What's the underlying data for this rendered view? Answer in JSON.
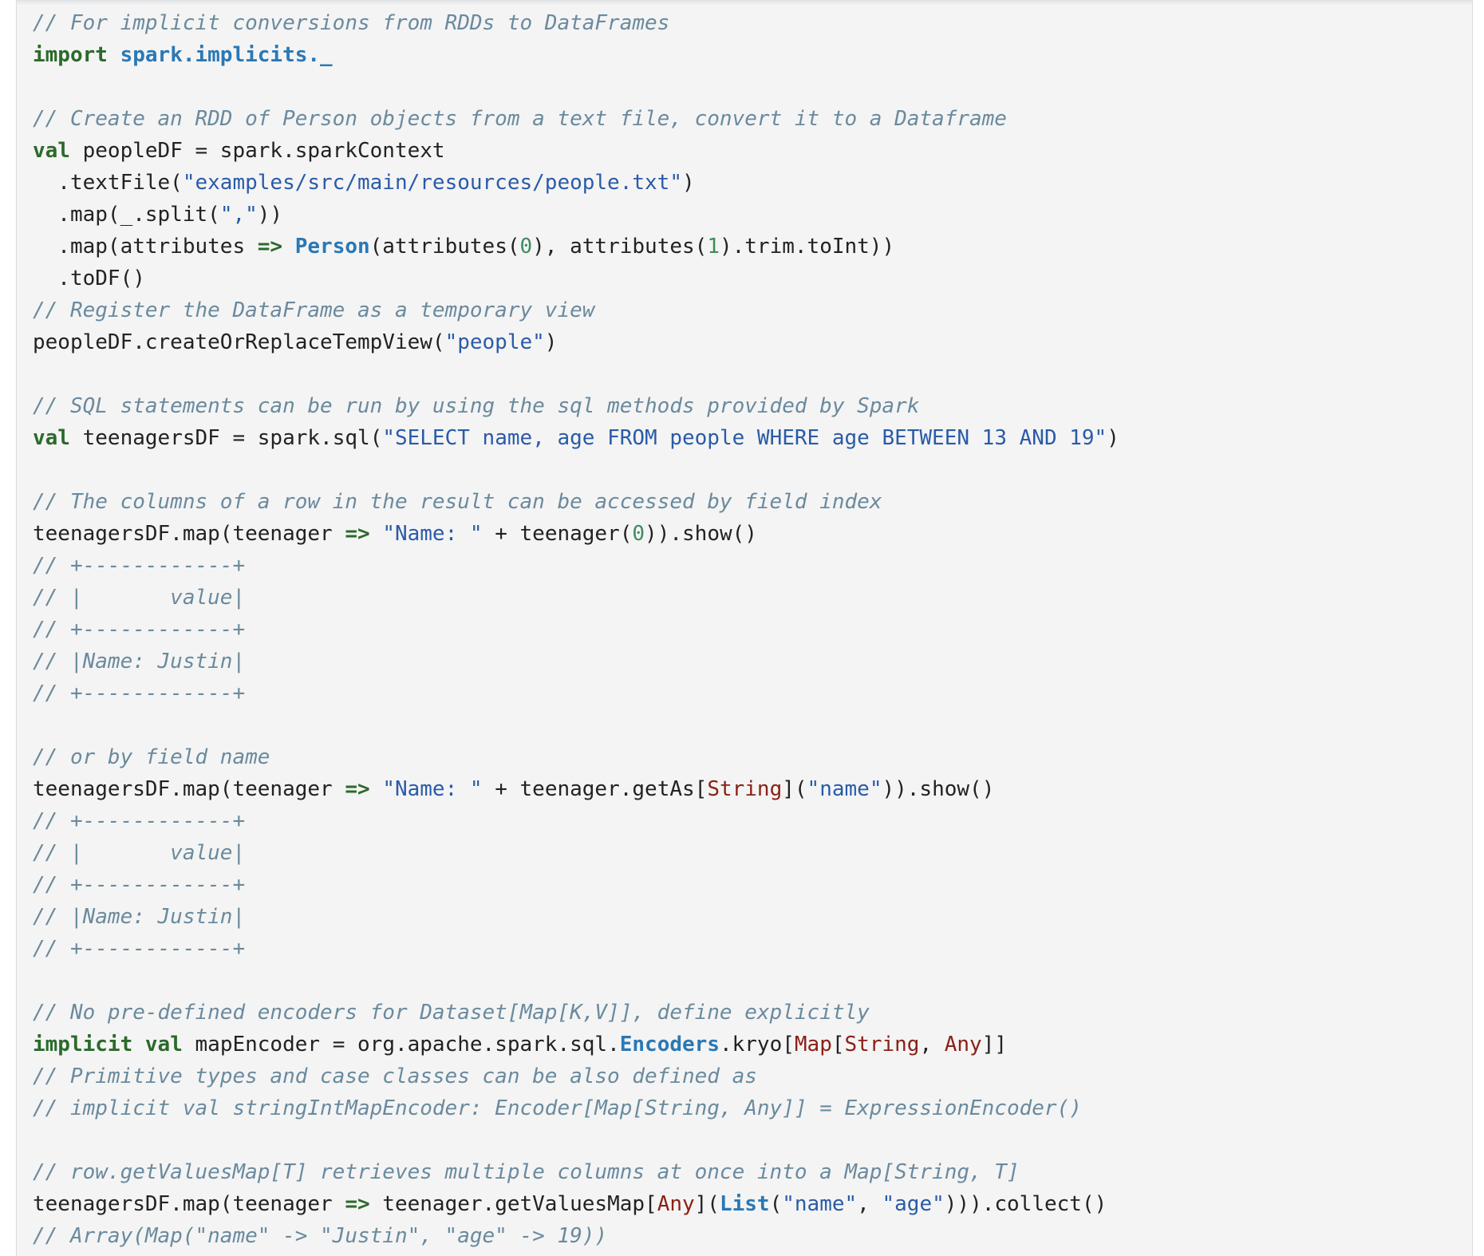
{
  "code": {
    "language": "scala",
    "lines": [
      [
        {
          "t": "c",
          "v": "// For implicit conversions from RDDs to DataFrames"
        }
      ],
      [
        {
          "t": "k",
          "v": "import"
        },
        {
          "t": "",
          "v": " "
        },
        {
          "t": "nc",
          "v": "spark.implicits._"
        }
      ],
      [],
      [
        {
          "t": "c",
          "v": "// Create an RDD of Person objects from a text file, convert it to a Dataframe"
        }
      ],
      [
        {
          "t": "k",
          "v": "val"
        },
        {
          "t": "",
          "v": " peopleDF = spark.sparkContext"
        }
      ],
      [
        {
          "t": "",
          "v": "  .textFile("
        },
        {
          "t": "s",
          "v": "\"examples/src/main/resources/people.txt\""
        },
        {
          "t": "",
          "v": ")"
        }
      ],
      [
        {
          "t": "",
          "v": "  .map(_.split("
        },
        {
          "t": "s",
          "v": "\",\""
        },
        {
          "t": "",
          "v": "))"
        }
      ],
      [
        {
          "t": "",
          "v": "  .map(attributes "
        },
        {
          "t": "k",
          "v": "=>"
        },
        {
          "t": "",
          "v": " "
        },
        {
          "t": "nc",
          "v": "Person"
        },
        {
          "t": "",
          "v": "(attributes("
        },
        {
          "t": "n",
          "v": "0"
        },
        {
          "t": "",
          "v": "), attributes("
        },
        {
          "t": "n",
          "v": "1"
        },
        {
          "t": "",
          "v": ").trim.toInt))"
        }
      ],
      [
        {
          "t": "",
          "v": "  .toDF()"
        }
      ],
      [
        {
          "t": "c",
          "v": "// Register the DataFrame as a temporary view"
        }
      ],
      [
        {
          "t": "",
          "v": "peopleDF.createOrReplaceTempView("
        },
        {
          "t": "s",
          "v": "\"people\""
        },
        {
          "t": "",
          "v": ")"
        }
      ],
      [],
      [
        {
          "t": "c",
          "v": "// SQL statements can be run by using the sql methods provided by Spark"
        }
      ],
      [
        {
          "t": "k",
          "v": "val"
        },
        {
          "t": "",
          "v": " teenagersDF = spark.sql("
        },
        {
          "t": "s",
          "v": "\"SELECT name, age FROM people WHERE age BETWEEN 13 AND 19\""
        },
        {
          "t": "",
          "v": ")"
        }
      ],
      [],
      [
        {
          "t": "c",
          "v": "// The columns of a row in the result can be accessed by field index"
        }
      ],
      [
        {
          "t": "",
          "v": "teenagersDF.map(teenager "
        },
        {
          "t": "k",
          "v": "=>"
        },
        {
          "t": "",
          "v": " "
        },
        {
          "t": "s",
          "v": "\"Name: \""
        },
        {
          "t": "",
          "v": " + teenager("
        },
        {
          "t": "n",
          "v": "0"
        },
        {
          "t": "",
          "v": ")).show()"
        }
      ],
      [
        {
          "t": "c",
          "v": "// +------------+"
        }
      ],
      [
        {
          "t": "c",
          "v": "// |       value|"
        }
      ],
      [
        {
          "t": "c",
          "v": "// +------------+"
        }
      ],
      [
        {
          "t": "c",
          "v": "// |Name: Justin|"
        }
      ],
      [
        {
          "t": "c",
          "v": "// +------------+"
        }
      ],
      [],
      [
        {
          "t": "c",
          "v": "// or by field name"
        }
      ],
      [
        {
          "t": "",
          "v": "teenagersDF.map(teenager "
        },
        {
          "t": "k",
          "v": "=>"
        },
        {
          "t": "",
          "v": " "
        },
        {
          "t": "s",
          "v": "\"Name: \""
        },
        {
          "t": "",
          "v": " + teenager.getAs["
        },
        {
          "t": "t",
          "v": "String"
        },
        {
          "t": "",
          "v": "]("
        },
        {
          "t": "s",
          "v": "\"name\""
        },
        {
          "t": "",
          "v": ")).show()"
        }
      ],
      [
        {
          "t": "c",
          "v": "// +------------+"
        }
      ],
      [
        {
          "t": "c",
          "v": "// |       value|"
        }
      ],
      [
        {
          "t": "c",
          "v": "// +------------+"
        }
      ],
      [
        {
          "t": "c",
          "v": "// |Name: Justin|"
        }
      ],
      [
        {
          "t": "c",
          "v": "// +------------+"
        }
      ],
      [],
      [
        {
          "t": "c",
          "v": "// No pre-defined encoders for Dataset[Map[K,V]], define explicitly"
        }
      ],
      [
        {
          "t": "k",
          "v": "implicit"
        },
        {
          "t": "",
          "v": " "
        },
        {
          "t": "k",
          "v": "val"
        },
        {
          "t": "",
          "v": " mapEncoder = org.apache.spark.sql."
        },
        {
          "t": "nc",
          "v": "Encoders"
        },
        {
          "t": "",
          "v": ".kryo["
        },
        {
          "t": "t",
          "v": "Map"
        },
        {
          "t": "",
          "v": "["
        },
        {
          "t": "t",
          "v": "String"
        },
        {
          "t": "",
          "v": ", "
        },
        {
          "t": "t",
          "v": "Any"
        },
        {
          "t": "",
          "v": "]]"
        }
      ],
      [
        {
          "t": "c",
          "v": "// Primitive types and case classes can be also defined as"
        }
      ],
      [
        {
          "t": "c",
          "v": "// implicit val stringIntMapEncoder: Encoder[Map[String, Any]] = ExpressionEncoder()"
        }
      ],
      [],
      [
        {
          "t": "c",
          "v": "// row.getValuesMap[T] retrieves multiple columns at once into a Map[String, T]"
        }
      ],
      [
        {
          "t": "",
          "v": "teenagersDF.map(teenager "
        },
        {
          "t": "k",
          "v": "=>"
        },
        {
          "t": "",
          "v": " teenager.getValuesMap["
        },
        {
          "t": "t",
          "v": "Any"
        },
        {
          "t": "",
          "v": "]("
        },
        {
          "t": "nc",
          "v": "List"
        },
        {
          "t": "",
          "v": "("
        },
        {
          "t": "s",
          "v": "\"name\""
        },
        {
          "t": "",
          "v": ", "
        },
        {
          "t": "s",
          "v": "\"age\""
        },
        {
          "t": "",
          "v": "))).collect()"
        }
      ],
      [
        {
          "t": "c",
          "v": "// Array(Map(\"name\" -> \"Justin\", \"age\" -> 19))"
        }
      ]
    ]
  },
  "colors": {
    "background": "#f4f4f4",
    "comment": "#6a8a9e",
    "keyword": "#2b6a2b",
    "string": "#2a5ba8",
    "number": "#3d8c5c",
    "type": "#8b2016",
    "class": "#2a78b5",
    "text": "#222222"
  }
}
